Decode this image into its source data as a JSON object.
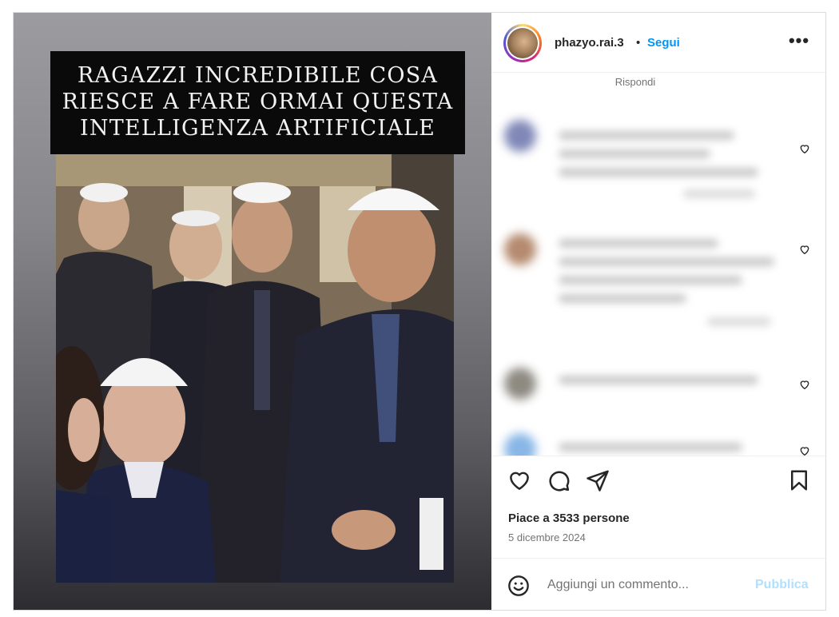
{
  "post": {
    "caption_lines": [
      "RAGAZZI INCREDIBILE COSA",
      "RIESCE A FARE ORMAI QUESTA",
      "INTELLIGENZA ARTIFICIALE"
    ]
  },
  "header": {
    "username": "phazyo.rai.3",
    "separator": "•",
    "follow_label": "Segui",
    "more_icon": "more-horizontal-icon",
    "more_label": "•••"
  },
  "comments": {
    "reply_label": "Rispondi",
    "heart_icon": "heart-outline-icon"
  },
  "actions": {
    "like_icon": "heart-icon",
    "comment_icon": "comment-bubble-icon",
    "share_icon": "paper-plane-icon",
    "save_icon": "bookmark-icon",
    "likes_text": "Piace a 3533 persone",
    "date_text": "5 dicembre 2024"
  },
  "compose": {
    "emoji_icon": "smiley-face-icon",
    "placeholder": "Aggiungi un commento...",
    "publish_label": "Pubblica"
  },
  "colors": {
    "link_blue": "#0095f6",
    "publish_disabled": "#b2dffc",
    "border": "#dbdbdb",
    "text": "#262626",
    "secondary_text": "#737373"
  }
}
